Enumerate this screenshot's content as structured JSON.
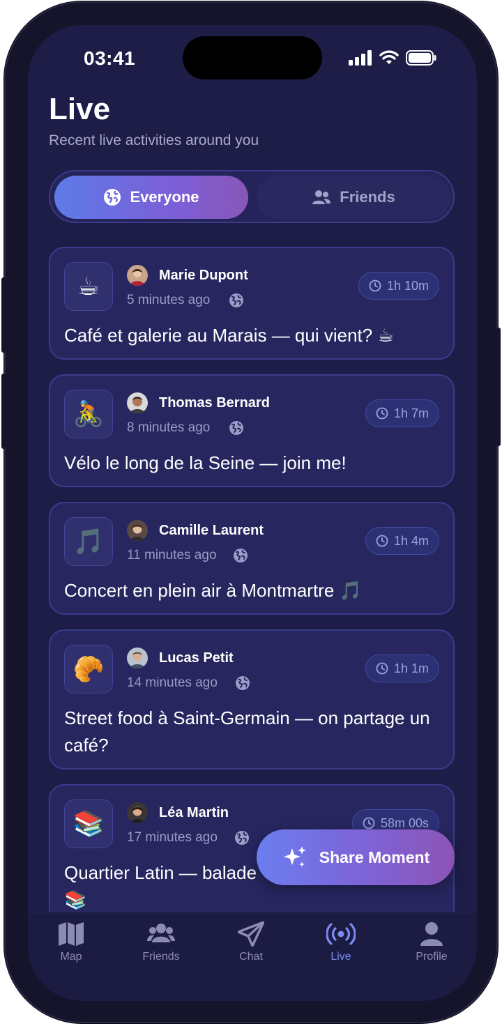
{
  "status": {
    "time": "03:41"
  },
  "header": {
    "title": "Live",
    "subtitle": "Recent live activities around you"
  },
  "tabs": [
    {
      "label": "Everyone",
      "active": true,
      "icon": "globe-icon"
    },
    {
      "label": "Friends",
      "active": false,
      "icon": "users-icon"
    }
  ],
  "feed": [
    {
      "emoji": "☕",
      "user": "Marie Dupont",
      "ago": "5 minutes ago",
      "remaining": "1h 10m",
      "text": "Café et galerie au Marais — qui vient? ☕"
    },
    {
      "emoji": "🚴",
      "user": "Thomas Bernard",
      "ago": "8 minutes ago",
      "remaining": "1h 7m",
      "text": "Vélo le long de la Seine — join me!"
    },
    {
      "emoji": "🎵",
      "user": "Camille Laurent",
      "ago": "11 minutes ago",
      "remaining": "1h 4m",
      "text": "Concert en plein air à Montmartre 🎵"
    },
    {
      "emoji": "🥐",
      "user": "Lucas Petit",
      "ago": "14 minutes ago",
      "remaining": "1h 1m",
      "text": "Street food à Saint-Germain — on partage un café?"
    },
    {
      "emoji": "📚",
      "user": "Léa Martin",
      "ago": "17 minutes ago",
      "remaining": "58m 00s",
      "text": "Quartier Latin — balade 📚"
    }
  ],
  "fab": {
    "label": "Share Moment",
    "icon": "sparkles-icon"
  },
  "nav": [
    {
      "label": "Map",
      "icon": "map-icon",
      "active": false
    },
    {
      "label": "Friends",
      "icon": "users-icon",
      "active": false
    },
    {
      "label": "Chat",
      "icon": "send-icon",
      "active": false
    },
    {
      "label": "Live",
      "icon": "broadcast-icon",
      "active": true
    },
    {
      "label": "Profile",
      "icon": "person-icon",
      "active": false
    }
  ],
  "colors": {
    "background": "#1e1d48",
    "card": "#27265f",
    "accent": "#7b8cf5",
    "gradient_start": "#5e7be8",
    "gradient_end": "#8a56b8"
  }
}
